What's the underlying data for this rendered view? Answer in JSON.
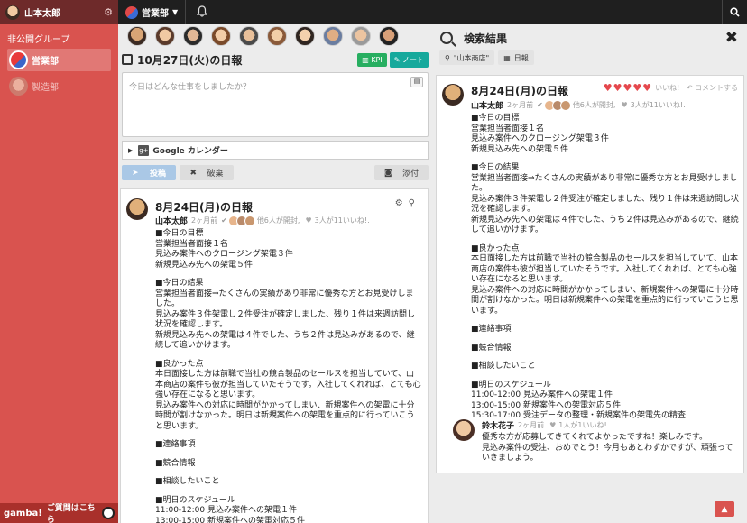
{
  "user": {
    "name": "山本太郎"
  },
  "topbar": {
    "group_name": "営業部"
  },
  "sidebar": {
    "section_title": "非公開グループ",
    "items": [
      {
        "label": "営業部",
        "active": true
      },
      {
        "label": "製造部",
        "active": false
      }
    ],
    "footer": {
      "brand": "gamba!",
      "help": "ご質問はこちら"
    }
  },
  "members": {
    "count": 10
  },
  "diary": {
    "date_title": "10月27日(火)の日報",
    "kpi_label": "KPI",
    "note_label": "ノート",
    "compose_placeholder": "今日はどんな仕事をしましたか？",
    "gcal_label": "Google カレンダー",
    "post_label": "投稿",
    "discard_label": "破棄",
    "attach_label": "添付"
  },
  "post": {
    "title": "8月24日(月)の日報",
    "author": "山本太郎",
    "time": "2ヶ月前",
    "opened": "他6人が開封,",
    "likes": "3人が11いいね!.",
    "paragraphs": [
      "■今日の目標\n営業担当者面接１名\n見込み案件へのクロージング架電３件\n新規見込み先への架電５件",
      "■今日の結果\n営業担当者面接⇒たくさんの実績があり非常に優秀な方とお見受けしました。\n見込み案件３件架電し２件受注が確定しました、残り１件は来週訪問し状況を確認します。\n新規見込み先への架電は４件でした、うち２件は見込みがあるので、継続して追いかけます。",
      "■良かった点\n本日面接した方は前職で当社の競合製品のセールスを担当していて、山本商店の案件も彼が担当していたそうです。入社してくれれば、とても心強い存在になると思います。\n見込み案件への対応に時間がかかってしまい、新規案件への架電に十分時間が割けなかった。明日は新規案件への架電を重点的に行っていこうと思います。",
      "■連絡事項",
      "■競合情報",
      "■相談したいこと",
      "■明日のスケジュール\n11:00-12:00 見込み案件への架電１件\n13:00-15:00 新規案件への架電対応５件\n15:30-17:00 受注データの整理・新規案件の架電先の精査"
    ]
  },
  "search": {
    "title": "検索結果",
    "chips": [
      {
        "icon": "search-icon",
        "label": "\"山本商店\""
      },
      {
        "icon": "calendar-icon",
        "label": "日報"
      }
    ],
    "result": {
      "title": "8月24日(月)の日報",
      "hearts": "♥♥♥♥♥",
      "like_label": "いいね!",
      "comment_label": "コメントする",
      "author": "山本太郎",
      "time": "2ヶ月前",
      "opened": "他6人が開封,",
      "likes": "3人が11いいね!.",
      "reply": {
        "author": "鈴木花子",
        "time": "2ヶ月前",
        "likes": "1人が1いいね!.",
        "text": "優秀な方が応募してきてくれてよかったですね！楽しみです。\n見込み案件の受注、おめでとう！今月もあとわずかですが、頑張っていきましょう。"
      }
    }
  }
}
